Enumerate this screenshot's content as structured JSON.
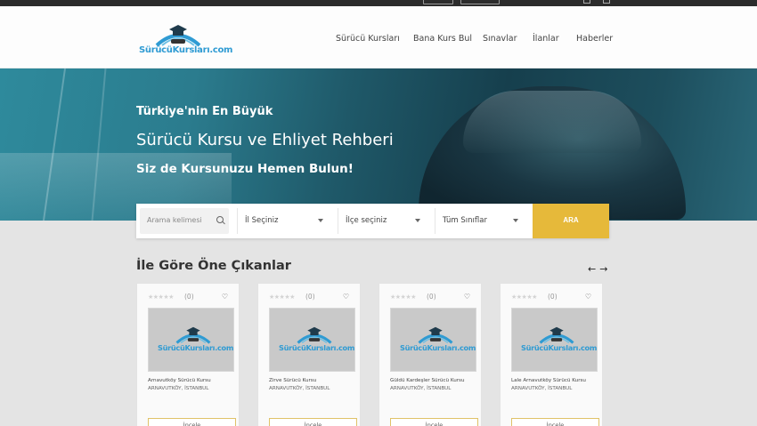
{
  "header": {
    "logo_text": "SürücüKursları.com",
    "nav": [
      "Sürücü Kursları",
      "Bana Kurs Bul",
      "Sınavlar",
      "İlanlar",
      "Haberler"
    ]
  },
  "hero": {
    "line1": "Türkiye'nin En Büyük",
    "line2": "Sürücü Kursu ve Ehliyet Rehberi",
    "line3": "Siz de Kursunuzu Hemen Bulun!"
  },
  "search": {
    "keyword_placeholder": "Arama kelimesi",
    "city": "İl Seçiniz",
    "district": "İlçe seçiniz",
    "class": "Tüm Sınıflar",
    "button": "ARA"
  },
  "section": {
    "title": "İle Göre Öne Çıkanlar",
    "prev": "←",
    "next": "→"
  },
  "cards": [
    {
      "name": "Arnavutköy Sürücü Kursu",
      "location": "ARNAVUTKÖY, İSTANBUL",
      "count": "(0)",
      "rating": 0,
      "button": "İncele",
      "thumb_text": "SürücüKursları.com"
    },
    {
      "name": "Zirve Sürücü Kursu",
      "location": "ARNAVUTKÖY, İSTANBUL",
      "count": "(0)",
      "rating": 0,
      "button": "İncele",
      "thumb_text": "SürücüKursları.com"
    },
    {
      "name": "Güldü Kardeşler Sürücü Kursu",
      "location": "ARNAVUTKÖY, İSTANBUL",
      "count": "(0)",
      "rating": 0,
      "button": "İncele",
      "thumb_text": "SürücüKursları.com"
    },
    {
      "name": "Lale Arnavutköy Sürücü Kursu",
      "location": "ARNAVUTKÖY, İSTANBUL",
      "count": "(0)",
      "rating": 0,
      "button": "İncele",
      "thumb_text": "SürücüKursları.com"
    }
  ],
  "colors": {
    "accent": "#e6b93a",
    "brand_blue": "#2f9bd3",
    "hero_teal": "#2b7c8e"
  },
  "icons": [
    "search-icon",
    "chevron-down-icon",
    "heart-icon",
    "star-icon",
    "arrow-left-icon",
    "arrow-right-icon"
  ]
}
